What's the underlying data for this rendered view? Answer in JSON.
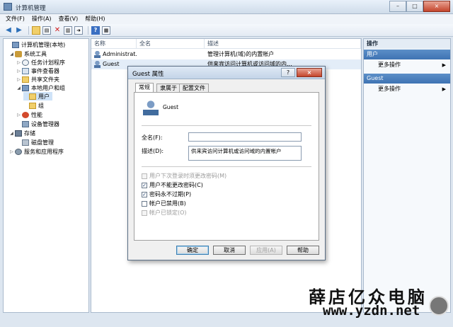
{
  "window": {
    "title": "计算机管理",
    "min_label": "–",
    "max_label": "□",
    "close_label": "×"
  },
  "menubar": [
    {
      "label": "文件(F)"
    },
    {
      "label": "操作(A)"
    },
    {
      "label": "查看(V)"
    },
    {
      "label": "帮助(H)"
    }
  ],
  "toolbar": {
    "icons": [
      "back-arrow-icon",
      "forward-arrow-icon",
      "up-folder-icon",
      "show-hide-tree-icon",
      "delete-icon",
      "properties-icon",
      "export-icon",
      "help-icon",
      "console-icon"
    ]
  },
  "tree": [
    {
      "label": "计算机管理(本地)",
      "icon": "computer-icon",
      "expand": ""
    },
    {
      "label": "系统工具",
      "icon": "tools-icon",
      "expand": "◢"
    },
    {
      "label": "任务计划程序",
      "icon": "clock-icon",
      "expand": "▷"
    },
    {
      "label": "事件查看器",
      "icon": "event-viewer-icon",
      "expand": "▷"
    },
    {
      "label": "共享文件夹",
      "icon": "shared-folder-icon",
      "expand": "▷"
    },
    {
      "label": "本地用户和组",
      "icon": "users-groups-icon",
      "expand": "◢"
    },
    {
      "label": "用户",
      "icon": "folder-icon",
      "expand": ""
    },
    {
      "label": "组",
      "icon": "folder-icon",
      "expand": ""
    },
    {
      "label": "性能",
      "icon": "performance-icon",
      "expand": "▷"
    },
    {
      "label": "设备管理器",
      "icon": "device-manager-icon",
      "expand": ""
    },
    {
      "label": "存储",
      "icon": "storage-icon",
      "expand": "◢"
    },
    {
      "label": "磁盘管理",
      "icon": "disk-icon",
      "expand": ""
    },
    {
      "label": "服务和应用程序",
      "icon": "services-icon",
      "expand": "▷"
    }
  ],
  "list": {
    "columns": [
      "名称",
      "全名",
      "描述"
    ],
    "rows": [
      {
        "name": "Administrat...",
        "fullname": "",
        "desc": "管理计算机(域)的内置帐户"
      },
      {
        "name": "Guest",
        "fullname": "",
        "desc": "供来宾访问计算机或访问域的内..."
      }
    ]
  },
  "actions": {
    "title": "操作",
    "groups": [
      {
        "header": "用户",
        "items": [
          {
            "label": "更多操作",
            "arrow": "▶"
          }
        ]
      },
      {
        "header": "Guest",
        "items": [
          {
            "label": "更多操作",
            "arrow": "▶"
          }
        ]
      }
    ]
  },
  "dialog": {
    "title": "Guest 属性",
    "help_label": "?",
    "close_label": "×",
    "tabs": [
      "常规",
      "隶属于",
      "配置文件"
    ],
    "username": "Guest",
    "fullname_label": "全名(F):",
    "fullname_value": "",
    "desc_label": "描述(D):",
    "desc_value": "供来宾访问计算机或访问域的内置帐户",
    "checkboxes": [
      {
        "label": "用户下次登录时须更改密码(M)",
        "checked": false,
        "disabled": true
      },
      {
        "label": "用户不能更改密码(C)",
        "checked": true,
        "disabled": false
      },
      {
        "label": "密码永不过期(P)",
        "checked": true,
        "disabled": false
      },
      {
        "label": "帐户已禁用(B)",
        "checked": false,
        "disabled": false
      },
      {
        "label": "帐户已锁定(O)",
        "checked": false,
        "disabled": true
      }
    ],
    "buttons": {
      "ok": "确定",
      "cancel": "取消",
      "apply": "应用(A)",
      "help": "帮助"
    }
  },
  "watermark": {
    "line1": "薛店亿众电脑",
    "line2": "www.yzdn.net"
  }
}
